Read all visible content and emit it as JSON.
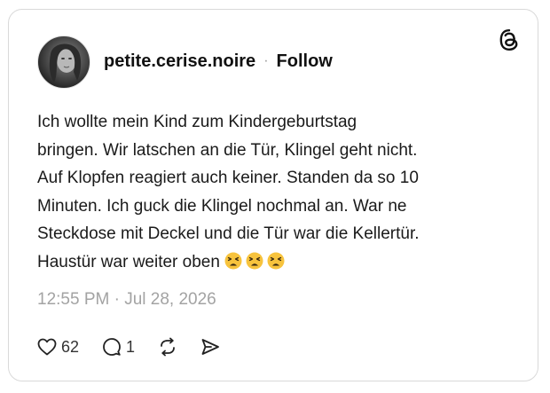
{
  "post": {
    "username": "petite.cerise.noire",
    "separator": "·",
    "follow_label": "Follow",
    "text_lines": [
      "Ich wollte mein Kind zum Kindergeburtstag",
      "bringen. Wir latschen an die Tür, Klingel geht nicht.",
      "Auf Klopfen reagiert auch keiner. Standen da so 10",
      "Minuten. Ich guck die Klingel nochmal an. War ne",
      "Steckdose mit Deckel und die Tür war die Kellertür.",
      "Haustür war weiter oben"
    ],
    "emojis": [
      "tired-face-emoji",
      "tired-face-emoji",
      "tired-face-emoji"
    ],
    "timestamp": "12:55 PM · Jul 28, 2026"
  },
  "actions": {
    "like_count": "62",
    "reply_count": "1",
    "icons": [
      "heart-icon",
      "comment-icon",
      "repost-icon",
      "share-icon"
    ]
  },
  "colors": {
    "text": "#1a1a1a",
    "muted": "#a3a3a3",
    "border": "#d9d9d9",
    "emoji": "#f7c33d"
  }
}
